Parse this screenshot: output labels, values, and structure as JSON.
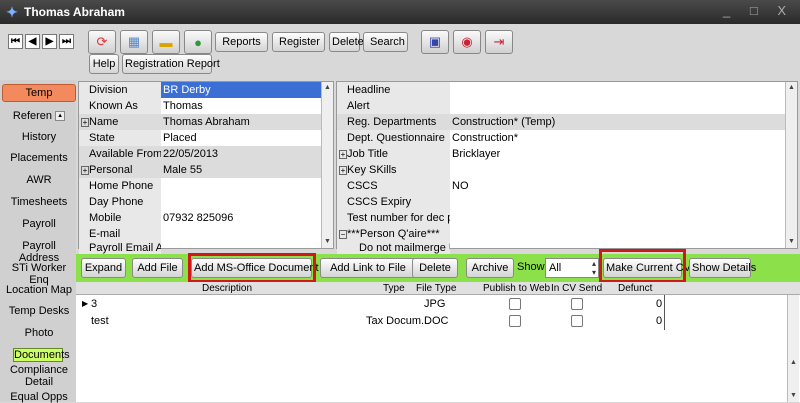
{
  "window": {
    "title": "Thomas Abraham",
    "controls": "_ □ X"
  },
  "toolbar": {
    "nav_first": "⏮",
    "nav_prev": "◀",
    "nav_next": "▶",
    "nav_last": "⏭",
    "icons_left": [
      "refresh-icon",
      "calendar-icon",
      "notes-icon",
      "chat-icon"
    ],
    "reports": "Reports",
    "register": "Register",
    "delete": "Delete",
    "search": "Search",
    "icons_right": [
      "print-icon",
      "stats-icon",
      "exit-icon"
    ],
    "help": "Help",
    "registration_report": "Registration Report"
  },
  "sidebar": {
    "items": [
      "Temp",
      "Referen",
      "History",
      "Placements",
      "AWR",
      "Timesheets",
      "Payroll",
      "Payroll Address",
      "STi Worker Enq",
      "Location Map",
      "Temp Desks",
      "Photo",
      "Documents",
      "Compliance Detail",
      "Equal Opps"
    ]
  },
  "left_grid": {
    "rows": [
      {
        "label": "Division",
        "value": "BR Derby"
      },
      {
        "label": "Known As",
        "value": "Thomas"
      },
      {
        "label": "Name",
        "value": "Thomas Abraham",
        "expand": "+"
      },
      {
        "label": "State",
        "value": "Placed"
      },
      {
        "label": "Available From",
        "value": "22/05/2013"
      },
      {
        "label": "Personal",
        "value": "Male 55",
        "expand": "+"
      },
      {
        "label": "Home Phone",
        "value": ""
      },
      {
        "label": "Day Phone",
        "value": ""
      },
      {
        "label": "Mobile",
        "value": "07932 825096"
      },
      {
        "label": "E-mail",
        "value": ""
      },
      {
        "label": "Payroll Email Add",
        "value": ""
      }
    ]
  },
  "right_grid": {
    "rows": [
      {
        "label": "Headline",
        "value": ""
      },
      {
        "label": "Alert",
        "value": ""
      },
      {
        "label": "Reg. Departments",
        "value": "Construction* (Temp)"
      },
      {
        "label": "Dept. Questionnaire",
        "value": "Construction*"
      },
      {
        "label": "Job Title",
        "value": "Bricklayer",
        "expand": "+"
      },
      {
        "label": "Key SKills",
        "value": "",
        "expand": "+"
      },
      {
        "label": "CSCS",
        "value": "NO"
      },
      {
        "label": "CSCS Expiry",
        "value": ""
      },
      {
        "label": "Test number for dec pla",
        "value": ""
      },
      {
        "label": "***Person Q'aire***",
        "value": "",
        "expand": "−"
      },
      {
        "label": "Do not mailmerge UNT",
        "value": ""
      }
    ]
  },
  "actions": {
    "expand": "Expand",
    "add_file": "Add File",
    "add_ms_office": "Add MS-Office Document",
    "add_link": "Add Link to File",
    "delete": "Delete",
    "archive": "Archive",
    "show_label": "Show",
    "show_value": "All",
    "make_current_cv": "Make Current CV",
    "show_details": "Show Details"
  },
  "documents": {
    "columns": [
      "Description",
      "Type",
      "File Type",
      "Publish to Web",
      "In CV Send",
      "Defunct"
    ],
    "rows": [
      {
        "description": "3",
        "type": "",
        "file_type": "JPG",
        "defunct": "0"
      },
      {
        "description": "test",
        "type": "Tax Docum...",
        "file_type": "DOC",
        "defunct": "0"
      }
    ]
  }
}
